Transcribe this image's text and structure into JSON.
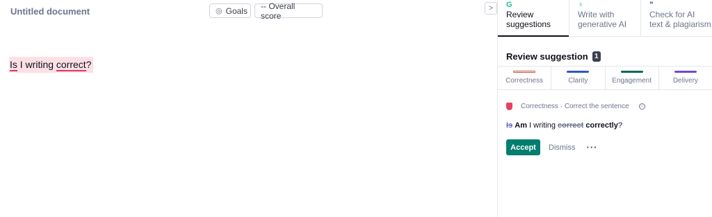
{
  "editor": {
    "doc_title": "Untitled document",
    "goals_label": "Goals",
    "goals_icon": "goals-icon",
    "score_label": "-- Overall score",
    "text_before": "Is",
    "text_mid1": " I writing ",
    "text_flagged": "correct",
    "text_after": "?"
  },
  "collapse_glyph": ">",
  "sidebar": {
    "tabs": [
      {
        "label1": "Review",
        "label2": "suggestions",
        "icon": "grammarly-icon"
      },
      {
        "label1": "Write with",
        "label2": "generative AI",
        "icon": "lightbulb-icon"
      },
      {
        "label1": "Check for AI",
        "label2": "text & plagiarism",
        "icon": "quote-icon"
      }
    ],
    "review_title": "Review suggestion",
    "review_count": "1",
    "categories": [
      {
        "label": "Correctness",
        "color": "#c5524a"
      },
      {
        "label": "Clarity",
        "color": "#2e56c6"
      },
      {
        "label": "Engagement",
        "color": "#056956"
      },
      {
        "label": "Delivery",
        "color": "#6c4ad7"
      }
    ],
    "card": {
      "category": "Correctness",
      "separator": "·",
      "description": "Correct the sentence",
      "old1": "Is",
      "new1": "Am",
      "mid": " I writing ",
      "old2": "correct",
      "new2": "correctly",
      "end": "?",
      "accept_label": "Accept",
      "dismiss_label": "Dismiss",
      "more_label": "···"
    }
  }
}
